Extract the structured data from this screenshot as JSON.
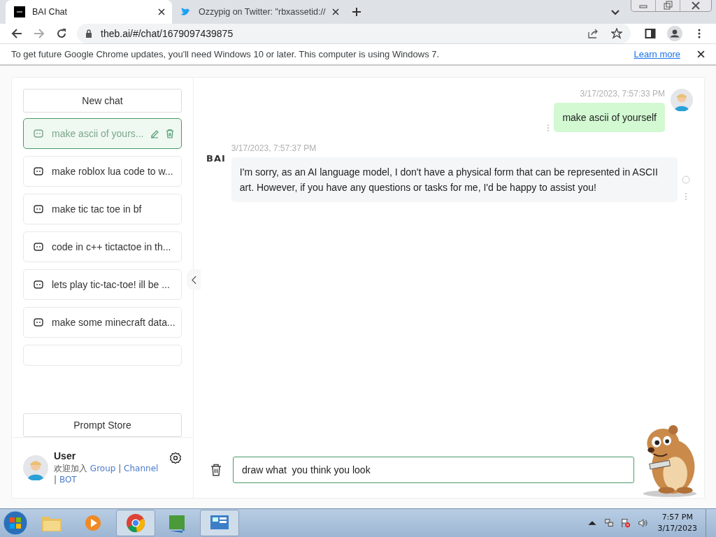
{
  "browser": {
    "tabs": [
      {
        "title": "BAI Chat",
        "selected": true
      },
      {
        "title": "Ozzypig on Twitter: \"rbxassetid://",
        "selected": false
      }
    ],
    "address": "theb.ai/#/chat/1679097439875"
  },
  "infobar": {
    "message": "To get future Google Chrome updates, you'll need Windows 10 or later. This computer is using Windows 7.",
    "link": "Learn more"
  },
  "sidebar": {
    "new_chat": "New chat",
    "chats": [
      {
        "title": "make ascii of yours...",
        "selected": true
      },
      {
        "title": "make roblox lua code to w...",
        "selected": false
      },
      {
        "title": "make tic tac toe in bf",
        "selected": false
      },
      {
        "title": "code in c++ tictactoe in th...",
        "selected": false
      },
      {
        "title": "lets play tic-tac-toe! ill be ...",
        "selected": false
      },
      {
        "title": "make some minecraft data...",
        "selected": false
      }
    ],
    "prompt_store": "Prompt Store",
    "user": {
      "name": "User",
      "join_line": [
        {
          "kind": "text",
          "text": "欢迎加入"
        },
        {
          "kind": "link",
          "text": "Group"
        },
        {
          "kind": "text",
          "text": "|"
        },
        {
          "kind": "link",
          "text": "Channel"
        },
        {
          "kind": "text",
          "text": "|"
        },
        {
          "kind": "link",
          "text": "BOT"
        }
      ]
    }
  },
  "messages": [
    {
      "kind": "user",
      "time": "3/17/2023, 7:57:33 PM",
      "text": "make ascii of yourself"
    },
    {
      "kind": "bot",
      "sender": "BAI",
      "time": "3/17/2023, 7:57:37 PM",
      "text": "I'm sorry, as an AI language model, I don't have a physical form that can be represented in ASCII art. However, if you have any questions or tasks for me, I'd be happy to assist you!"
    }
  ],
  "composer": {
    "value": "draw what  you think you look"
  },
  "taskbar": {
    "time": "7:57 PM",
    "date": "3/17/2023"
  }
}
